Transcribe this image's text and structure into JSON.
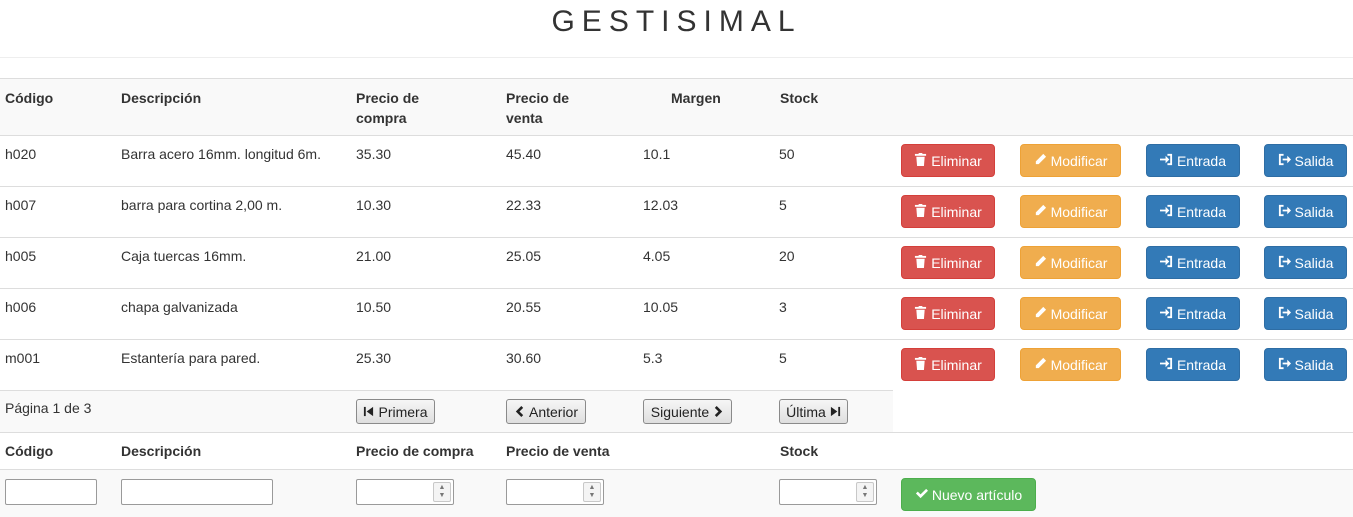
{
  "app_title": "GESTISIMAL",
  "table": {
    "headers": {
      "codigo": "Código",
      "descripcion": "Descripción",
      "precio_compra": "Precio de compra",
      "precio_venta": "Precio de venta",
      "margen": "Margen",
      "stock": "Stock"
    },
    "rows": [
      {
        "codigo": "h020",
        "descripcion": "Barra acero 16mm. longitud 6m.",
        "precio_compra": "35.30",
        "precio_venta": "45.40",
        "margen": "10.1",
        "stock": "50"
      },
      {
        "codigo": "h007",
        "descripcion": "barra para cortina 2,00 m.",
        "precio_compra": "10.30",
        "precio_venta": "22.33",
        "margen": "12.03",
        "stock": "5"
      },
      {
        "codigo": "h005",
        "descripcion": "Caja tuercas 16mm.",
        "precio_compra": "21.00",
        "precio_venta": "25.05",
        "margen": "4.05",
        "stock": "20"
      },
      {
        "codigo": "h006",
        "descripcion": "chapa galvanizada",
        "precio_compra": "10.50",
        "precio_venta": "20.55",
        "margen": "10.05",
        "stock": "3"
      },
      {
        "codigo": "m001",
        "descripcion": "Estantería para pared.",
        "precio_compra": "25.30",
        "precio_venta": "30.60",
        "margen": "5.3",
        "stock": "5"
      }
    ],
    "actions": {
      "eliminar": "Eliminar",
      "modificar": "Modificar",
      "entrada": "Entrada",
      "salida": "Salida"
    }
  },
  "pagination": {
    "page_info": "Página 1 de 3",
    "first": "Primera",
    "prev": "Anterior",
    "next": "Siguiente",
    "last": "Última"
  },
  "new_form": {
    "headers": {
      "codigo": "Código",
      "descripcion": "Descripción",
      "precio_compra": "Precio de compra",
      "precio_venta": "Precio de venta",
      "stock": "Stock"
    },
    "values": {
      "codigo": "",
      "descripcion": "",
      "precio_compra": "",
      "precio_venta": "",
      "stock": ""
    },
    "submit": "Nuevo artículo"
  },
  "colors": {
    "danger": "#d9534f",
    "warning": "#f0ad4e",
    "primary": "#337ab7",
    "success": "#5cb85c",
    "header_bg": "#f9f9f9",
    "border": "#dddddd"
  },
  "icons": {
    "eliminar": "trash-icon",
    "modificar": "pencil-icon",
    "entrada": "log-in-icon",
    "salida": "log-out-icon",
    "first": "step-backward-icon",
    "prev": "chevron-left-icon",
    "next": "chevron-right-icon",
    "last": "step-forward-icon",
    "submit": "check-icon"
  }
}
